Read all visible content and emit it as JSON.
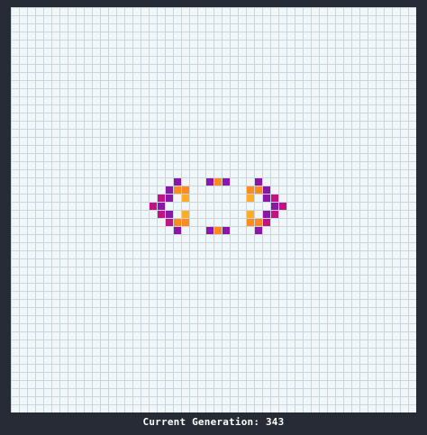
{
  "game": {
    "grid": {
      "cols": 50,
      "rows": 50
    },
    "colors": {
      "background": "#262b36",
      "board": "#f1f6f8",
      "grid_line": "#c9d5dc",
      "purple": "#8c16a8",
      "magenta": "#c21385",
      "orange": "#ff8a1e",
      "amber": "#ffab24"
    },
    "cells": [
      {
        "col": 20,
        "row": 21,
        "color": "purple"
      },
      {
        "col": 19,
        "row": 22,
        "color": "purple"
      },
      {
        "col": 20,
        "row": 22,
        "color": "orange"
      },
      {
        "col": 21,
        "row": 22,
        "color": "orange"
      },
      {
        "col": 18,
        "row": 23,
        "color": "magenta"
      },
      {
        "col": 19,
        "row": 23,
        "color": "purple"
      },
      {
        "col": 21,
        "row": 23,
        "color": "amber"
      },
      {
        "col": 17,
        "row": 24,
        "color": "magenta"
      },
      {
        "col": 18,
        "row": 24,
        "color": "purple"
      },
      {
        "col": 18,
        "row": 25,
        "color": "magenta"
      },
      {
        "col": 19,
        "row": 25,
        "color": "purple"
      },
      {
        "col": 21,
        "row": 25,
        "color": "amber"
      },
      {
        "col": 19,
        "row": 26,
        "color": "magenta"
      },
      {
        "col": 20,
        "row": 26,
        "color": "orange"
      },
      {
        "col": 21,
        "row": 26,
        "color": "orange"
      },
      {
        "col": 20,
        "row": 27,
        "color": "purple"
      },
      {
        "col": 24,
        "row": 21,
        "color": "purple"
      },
      {
        "col": 25,
        "row": 21,
        "color": "orange"
      },
      {
        "col": 26,
        "row": 21,
        "color": "purple"
      },
      {
        "col": 24,
        "row": 27,
        "color": "purple"
      },
      {
        "col": 25,
        "row": 27,
        "color": "orange"
      },
      {
        "col": 26,
        "row": 27,
        "color": "purple"
      },
      {
        "col": 30,
        "row": 21,
        "color": "purple"
      },
      {
        "col": 29,
        "row": 22,
        "color": "orange"
      },
      {
        "col": 30,
        "row": 22,
        "color": "orange"
      },
      {
        "col": 31,
        "row": 22,
        "color": "purple"
      },
      {
        "col": 29,
        "row": 23,
        "color": "amber"
      },
      {
        "col": 31,
        "row": 23,
        "color": "purple"
      },
      {
        "col": 32,
        "row": 23,
        "color": "magenta"
      },
      {
        "col": 32,
        "row": 24,
        "color": "purple"
      },
      {
        "col": 33,
        "row": 24,
        "color": "magenta"
      },
      {
        "col": 29,
        "row": 25,
        "color": "amber"
      },
      {
        "col": 31,
        "row": 25,
        "color": "purple"
      },
      {
        "col": 32,
        "row": 25,
        "color": "magenta"
      },
      {
        "col": 29,
        "row": 26,
        "color": "orange"
      },
      {
        "col": 30,
        "row": 26,
        "color": "orange"
      },
      {
        "col": 31,
        "row": 26,
        "color": "magenta"
      },
      {
        "col": 30,
        "row": 27,
        "color": "purple"
      }
    ]
  },
  "status": {
    "generation_text": "Current Generation: 343"
  }
}
